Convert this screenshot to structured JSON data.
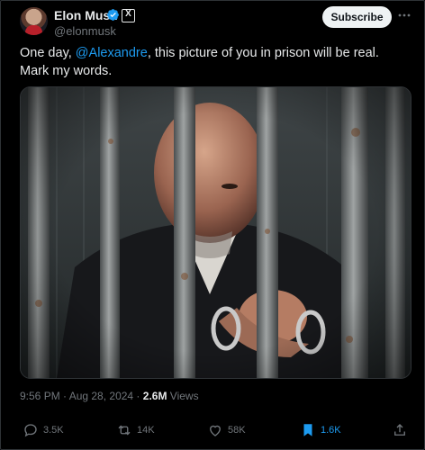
{
  "author": {
    "name": "Elon Musk",
    "handle": "@elonmusk",
    "x_badge": "X"
  },
  "header": {
    "subscribe_label": "Subscribe",
    "more_icon": "more-horizontal-icon"
  },
  "tweet": {
    "text_before": "One day, ",
    "mention": "@Alexandre",
    "text_after": ", this picture of you in prison will be real. Mark my words."
  },
  "meta": {
    "timestamp": "9:56 PM · Aug 28, 2024 · ",
    "views_count": "2.6M",
    "views_label": " Views"
  },
  "actions": {
    "replies": "3.5K",
    "reposts": "14K",
    "likes": "58K",
    "bookmarks": "1.6K"
  },
  "colors": {
    "background": "#000000",
    "text": "#e7e9ea",
    "muted": "#71767b",
    "accent": "#1d9bf0"
  }
}
